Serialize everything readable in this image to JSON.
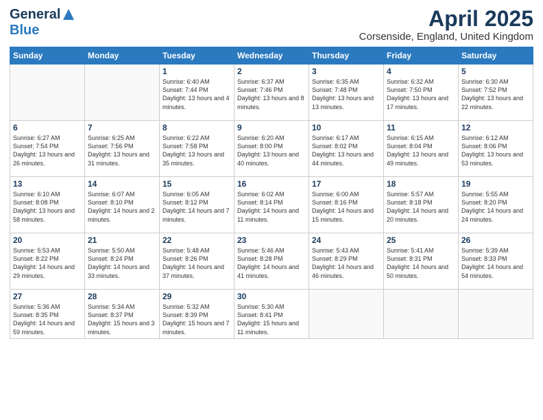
{
  "header": {
    "logo_general": "General",
    "logo_blue": "Blue",
    "title": "April 2025",
    "subtitle": "Corsenside, England, United Kingdom"
  },
  "weekdays": [
    "Sunday",
    "Monday",
    "Tuesday",
    "Wednesday",
    "Thursday",
    "Friday",
    "Saturday"
  ],
  "weeks": [
    [
      {
        "day": "",
        "info": ""
      },
      {
        "day": "",
        "info": ""
      },
      {
        "day": "1",
        "info": "Sunrise: 6:40 AM\nSunset: 7:44 PM\nDaylight: 13 hours and 4 minutes."
      },
      {
        "day": "2",
        "info": "Sunrise: 6:37 AM\nSunset: 7:46 PM\nDaylight: 13 hours and 8 minutes."
      },
      {
        "day": "3",
        "info": "Sunrise: 6:35 AM\nSunset: 7:48 PM\nDaylight: 13 hours and 13 minutes."
      },
      {
        "day": "4",
        "info": "Sunrise: 6:32 AM\nSunset: 7:50 PM\nDaylight: 13 hours and 17 minutes."
      },
      {
        "day": "5",
        "info": "Sunrise: 6:30 AM\nSunset: 7:52 PM\nDaylight: 13 hours and 22 minutes."
      }
    ],
    [
      {
        "day": "6",
        "info": "Sunrise: 6:27 AM\nSunset: 7:54 PM\nDaylight: 13 hours and 26 minutes."
      },
      {
        "day": "7",
        "info": "Sunrise: 6:25 AM\nSunset: 7:56 PM\nDaylight: 13 hours and 31 minutes."
      },
      {
        "day": "8",
        "info": "Sunrise: 6:22 AM\nSunset: 7:58 PM\nDaylight: 13 hours and 35 minutes."
      },
      {
        "day": "9",
        "info": "Sunrise: 6:20 AM\nSunset: 8:00 PM\nDaylight: 13 hours and 40 minutes."
      },
      {
        "day": "10",
        "info": "Sunrise: 6:17 AM\nSunset: 8:02 PM\nDaylight: 13 hours and 44 minutes."
      },
      {
        "day": "11",
        "info": "Sunrise: 6:15 AM\nSunset: 8:04 PM\nDaylight: 13 hours and 49 minutes."
      },
      {
        "day": "12",
        "info": "Sunrise: 6:12 AM\nSunset: 8:06 PM\nDaylight: 13 hours and 53 minutes."
      }
    ],
    [
      {
        "day": "13",
        "info": "Sunrise: 6:10 AM\nSunset: 8:08 PM\nDaylight: 13 hours and 58 minutes."
      },
      {
        "day": "14",
        "info": "Sunrise: 6:07 AM\nSunset: 8:10 PM\nDaylight: 14 hours and 2 minutes."
      },
      {
        "day": "15",
        "info": "Sunrise: 6:05 AM\nSunset: 8:12 PM\nDaylight: 14 hours and 7 minutes."
      },
      {
        "day": "16",
        "info": "Sunrise: 6:02 AM\nSunset: 8:14 PM\nDaylight: 14 hours and 11 minutes."
      },
      {
        "day": "17",
        "info": "Sunrise: 6:00 AM\nSunset: 8:16 PM\nDaylight: 14 hours and 15 minutes."
      },
      {
        "day": "18",
        "info": "Sunrise: 5:57 AM\nSunset: 8:18 PM\nDaylight: 14 hours and 20 minutes."
      },
      {
        "day": "19",
        "info": "Sunrise: 5:55 AM\nSunset: 8:20 PM\nDaylight: 14 hours and 24 minutes."
      }
    ],
    [
      {
        "day": "20",
        "info": "Sunrise: 5:53 AM\nSunset: 8:22 PM\nDaylight: 14 hours and 29 minutes."
      },
      {
        "day": "21",
        "info": "Sunrise: 5:50 AM\nSunset: 8:24 PM\nDaylight: 14 hours and 33 minutes."
      },
      {
        "day": "22",
        "info": "Sunrise: 5:48 AM\nSunset: 8:26 PM\nDaylight: 14 hours and 37 minutes."
      },
      {
        "day": "23",
        "info": "Sunrise: 5:46 AM\nSunset: 8:28 PM\nDaylight: 14 hours and 41 minutes."
      },
      {
        "day": "24",
        "info": "Sunrise: 5:43 AM\nSunset: 8:29 PM\nDaylight: 14 hours and 46 minutes."
      },
      {
        "day": "25",
        "info": "Sunrise: 5:41 AM\nSunset: 8:31 PM\nDaylight: 14 hours and 50 minutes."
      },
      {
        "day": "26",
        "info": "Sunrise: 5:39 AM\nSunset: 8:33 PM\nDaylight: 14 hours and 54 minutes."
      }
    ],
    [
      {
        "day": "27",
        "info": "Sunrise: 5:36 AM\nSunset: 8:35 PM\nDaylight: 14 hours and 59 minutes."
      },
      {
        "day": "28",
        "info": "Sunrise: 5:34 AM\nSunset: 8:37 PM\nDaylight: 15 hours and 3 minutes."
      },
      {
        "day": "29",
        "info": "Sunrise: 5:32 AM\nSunset: 8:39 PM\nDaylight: 15 hours and 7 minutes."
      },
      {
        "day": "30",
        "info": "Sunrise: 5:30 AM\nSunset: 8:41 PM\nDaylight: 15 hours and 11 minutes."
      },
      {
        "day": "",
        "info": ""
      },
      {
        "day": "",
        "info": ""
      },
      {
        "day": "",
        "info": ""
      }
    ]
  ]
}
